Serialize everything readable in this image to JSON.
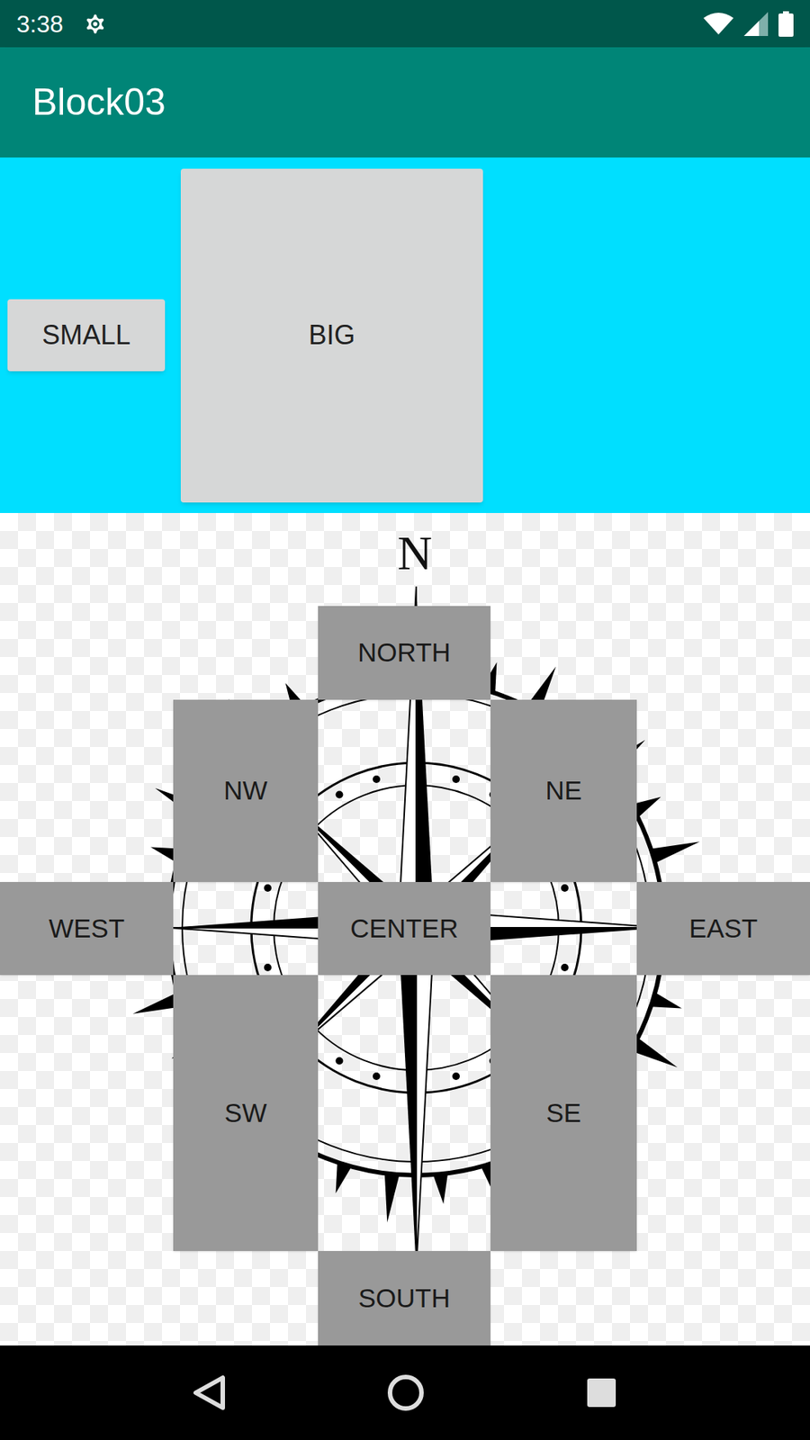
{
  "status_bar": {
    "time": "3:38"
  },
  "app_bar": {
    "title": "Block03"
  },
  "top_buttons": [
    "SMALL",
    "BIG"
  ],
  "compass": {
    "label": "N",
    "buttons": [
      "NORTH",
      "NW",
      "NE",
      "WEST",
      "CENTER",
      "EAST",
      "SW",
      "SE",
      "SOUTH"
    ]
  }
}
